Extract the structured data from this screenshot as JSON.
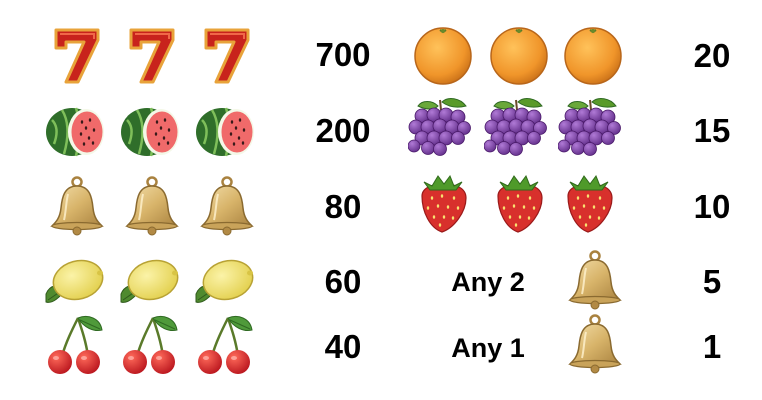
{
  "title": "",
  "colors": {
    "seven_red": "#c8231c",
    "seven_outline": "#e8a33a",
    "melon_rind": "#2f6e2a",
    "melon_flesh": "#f06a6a",
    "bell_gold": "#d8b46a",
    "lemon_yellow": "#f0e070",
    "leaf_green": "#4f8a2f",
    "cherry_red": "#d81e1e",
    "orange": "#f29a2a",
    "grape_purple": "#7a3fa0",
    "strawberry_red": "#d8302c"
  },
  "left_rows": [
    {
      "symbol": "seven-icon",
      "payout": "700"
    },
    {
      "symbol": "watermelon-icon",
      "payout": "200"
    },
    {
      "symbol": "bell-icon",
      "payout": "80"
    },
    {
      "symbol": "lemon-icon",
      "payout": "60"
    },
    {
      "symbol": "cherry-icon",
      "payout": "40"
    }
  ],
  "right_rows": [
    {
      "symbol": "orange-icon",
      "payout": "20"
    },
    {
      "symbol": "grapes-icon",
      "payout": "15"
    },
    {
      "symbol": "strawberry-icon",
      "payout": "10"
    },
    {
      "label": "Any 2",
      "symbol": "bell-icon",
      "payout": "5"
    },
    {
      "label": "Any 1",
      "symbol": "bell-icon",
      "payout": "1"
    }
  ]
}
